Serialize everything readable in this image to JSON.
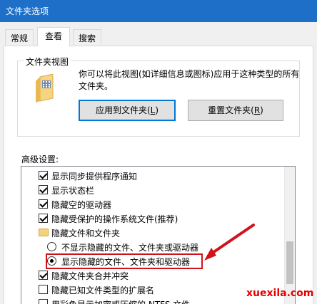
{
  "window": {
    "title": "文件夹选项"
  },
  "tabs": [
    {
      "label": "常规"
    },
    {
      "label": "查看"
    },
    {
      "label": "搜索"
    }
  ],
  "folder_view": {
    "legend": "文件夹视图",
    "description": "你可以将此视图(如详细信息或图标)应用于这种类型的所有文件夹。",
    "apply_button": {
      "text": "应用到文件夹(",
      "key": "L",
      "end": ")"
    },
    "reset_button": {
      "text": "重置文件夹(",
      "key": "R",
      "end": ")"
    }
  },
  "advanced": {
    "label": "高级设置:",
    "items": [
      {
        "type": "checkbox",
        "checked": true,
        "label": "显示同步提供程序通知"
      },
      {
        "type": "checkbox",
        "checked": true,
        "label": "显示状态栏"
      },
      {
        "type": "checkbox",
        "checked": true,
        "label": "隐藏空的驱动器"
      },
      {
        "type": "checkbox",
        "checked": true,
        "label": "隐藏受保护的操作系统文件(推荐)"
      },
      {
        "type": "folder",
        "label": "隐藏文件和文件夹"
      },
      {
        "type": "radio",
        "checked": false,
        "label": "不显示隐藏的文件、文件夹或驱动器"
      },
      {
        "type": "radio",
        "checked": true,
        "label": "显示隐藏的文件、文件夹和驱动器"
      },
      {
        "type": "checkbox",
        "checked": true,
        "label": "隐藏文件夹合并冲突"
      },
      {
        "type": "checkbox",
        "checked": false,
        "label": "隐藏已知文件类型的扩展名"
      },
      {
        "type": "checkbox",
        "checked": false,
        "label": "用彩色显示加密或压缩的 NTFS 文件"
      }
    ]
  },
  "watermark": "xuexila.com",
  "colors": {
    "titlebar": "#1e6fc8",
    "highlight": "#d0121b",
    "accent": "#0078d7"
  }
}
